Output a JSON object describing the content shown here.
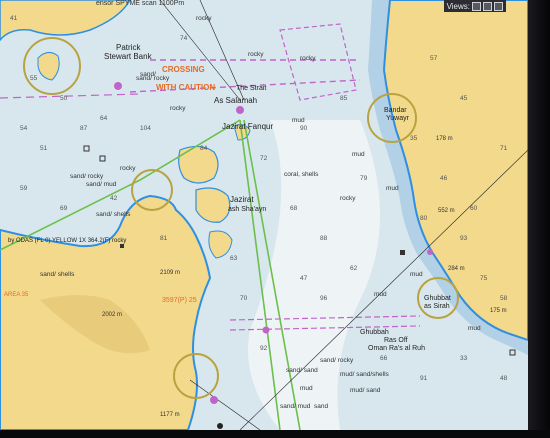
{
  "toolbar": {
    "views_label": "Views:",
    "top_label": "ensor SPYME scan 1100Pm"
  },
  "map": {
    "place_labels": {
      "patrick": "Patrick",
      "stewart_bank": "Stewart Bank",
      "as_salamah": "As Salamah",
      "jazirat_fanqur": "Jazirat Fanqur",
      "jazirat": "Jazirat",
      "ash_shasayn": "ash Sha'ayn",
      "bandar": "Bandar",
      "yuwayr": "Yuwayr",
      "ghubbat": "Ghubbat",
      "as_sirah": "as Sirah",
      "ras_off": "Ras Off",
      "oman": "Oman Ra's al Ruh",
      "ghubbah": "Ghubbah",
      "the_strait": "The Strait"
    },
    "warnings": {
      "crossing": "CROSSING",
      "with_caution": "WITH CAUTION"
    },
    "seabed": [
      "rocky",
      "rocky",
      "rocky",
      "rocky",
      "rocky",
      "rocky",
      "mud",
      "mud",
      "mud",
      "mud",
      "mud",
      "mud",
      "coral, shells",
      "sand/ rocky",
      "sand/ rocky",
      "sand/",
      "sand/ shells",
      "sand/ mud",
      "sand/ shells",
      "mud/ sand/shells",
      "mud/ sand",
      "sand",
      "sand/ mud",
      "mud",
      "sand/ rocky",
      "sand/ sand"
    ],
    "soundings": [
      "41",
      "55",
      "50",
      "51",
      "59",
      "64",
      "74",
      "84",
      "72",
      "68",
      "88",
      "85",
      "35",
      "46",
      "60",
      "80",
      "93",
      "75",
      "58",
      "62",
      "47",
      "70",
      "92",
      "96",
      "66",
      "91",
      "33",
      "48",
      "104",
      "87",
      "42",
      "69",
      "54",
      "81",
      "63",
      "79",
      "90",
      "57",
      "45",
      "71"
    ],
    "heights": [
      "178 m",
      "552 m",
      "284 m",
      "175 m",
      "2109 m",
      "2002 m",
      "1177 m"
    ],
    "line_labels": {
      "yellow_line": "by ODAS (FL 0) YELLOW 1X 364.2(F) rocky",
      "area_label": "AREA 35",
      "dredged": "3597(P) 25"
    },
    "colors": {
      "sea": "#d8e7ee",
      "deep_sea": "#eef3f6",
      "shallow": "#b2d0e6",
      "coast_blue": "#2f8fe0",
      "land": "#f2d98c",
      "land_dark": "#d9b35f",
      "traffic_pink": "#c065c8",
      "route_green": "#6bc04c",
      "warning_orange": "#e86a25",
      "light_ring": "#b8a340"
    }
  }
}
